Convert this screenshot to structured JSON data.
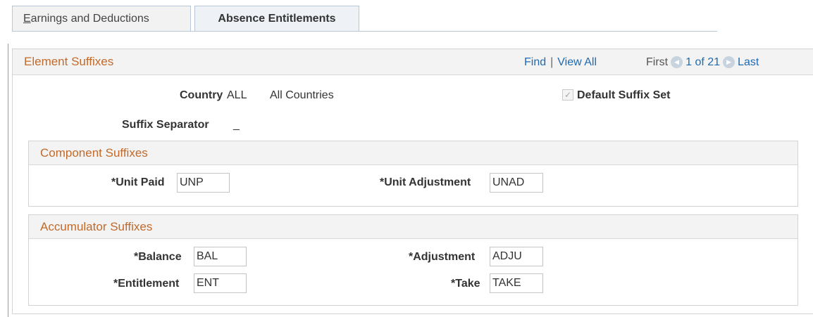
{
  "tabs": [
    {
      "label_accel": "E",
      "label_rest": "arnings and Deductions"
    },
    {
      "label": "Absence Entitlements"
    }
  ],
  "element_suffixes": {
    "title": "Element Suffixes",
    "find": "Find",
    "separator_char": "|",
    "view_all": "View All",
    "first": "First",
    "page_info": "1 of 21",
    "last": "Last"
  },
  "country": {
    "label": "Country",
    "code": "ALL",
    "description": "All Countries"
  },
  "default_suffix_set": {
    "label": "Default Suffix Set",
    "checked": true
  },
  "suffix_separator": {
    "label": "Suffix Separator",
    "value": "_"
  },
  "component_suffixes": {
    "title": "Component Suffixes",
    "unit_paid": {
      "label": "*Unit Paid",
      "value": "UNP"
    },
    "unit_adjustment": {
      "label": "*Unit Adjustment",
      "value": "UNAD"
    }
  },
  "accumulator_suffixes": {
    "title": "Accumulator Suffixes",
    "balance": {
      "label": "*Balance",
      "value": "BAL"
    },
    "adjustment": {
      "label": "*Adjustment",
      "value": "ADJU"
    },
    "entitlement": {
      "label": "*Entitlement",
      "value": "ENT"
    },
    "take": {
      "label": "*Take",
      "value": "TAKE"
    }
  },
  "icons": {
    "prev": "left-arrow-circle-icon",
    "next": "right-arrow-circle-icon",
    "check": "checkmark-icon"
  }
}
